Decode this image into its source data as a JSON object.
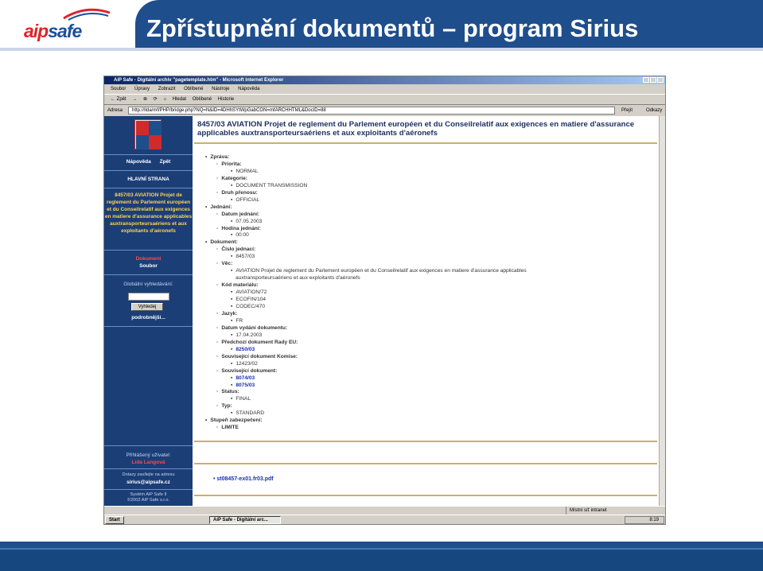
{
  "slide": {
    "logo_part1": "aip",
    "logo_part2": "safe",
    "title": "Zpřístupnění dokumentů – program Sirius"
  },
  "browser": {
    "window_title": "AiP Safe - Digitální archiv \"pagetemplate.htm\" - Microsoft Internet Explorer",
    "menu": [
      "Soubor",
      "Úpravy",
      "Zobrazit",
      "Oblíbené",
      "Nástroje",
      "Nápověda"
    ],
    "toolbar": [
      "← Zpět",
      "→",
      "⊗",
      "⟳",
      "⌂",
      "Hledat",
      "Oblíbené",
      "Historie"
    ],
    "address_label": "Adresa",
    "address_value": "http://Ilda/mf/PHP/bridge.php?NQ=N&ID=4DHhSYtWpGabCON=mfARCHHTML&DocID=88",
    "go_label": "Přejít",
    "links_label": "Odkazy",
    "status_zone": "Místní síť intranet"
  },
  "sidebar": {
    "help": "Nápověda",
    "back": "Zpět",
    "main_page": "HLAVNÍ STRANA",
    "doc_title": "8457/03 AVIATION Projet de reglement du Parlement européen et du Conseilrelatif aux exigences en matiere d'assurance applicables auxtransporteursaériens et aux exploitants d'aéronefs",
    "document_label": "Dokument",
    "file_label": "Soubor",
    "global_search": "Globální vyhledávání:",
    "search_button": "Vyhledej",
    "more": "podrobnější...",
    "logged_user_label": "Přihlášený uživatel:",
    "logged_user": "Lída Langová",
    "contact_label": "Dotazy zasílejte na adresu",
    "contact_email": "sirius@aipsafe.cz",
    "system": "Systém AiP Safe II",
    "copyright": "©2002 AiP Safe s.r.o."
  },
  "document": {
    "heading": "8457/03 AVIATION Projet de reglement du Parlement européen et du Conseilrelatif aux exigences en matiere d'assurance applicables auxtransporteursaériens et aux exploitants d'aéronefs",
    "tree": [
      {
        "level": 0,
        "text": "Zpráva:"
      },
      {
        "level": 1,
        "text": "Priorita:"
      },
      {
        "level": 2,
        "text": "NORMAL"
      },
      {
        "level": 1,
        "text": "Kategorie:"
      },
      {
        "level": 2,
        "text": "DOCUMENT TRANSMISSION"
      },
      {
        "level": 1,
        "text": "Druh přenosu:"
      },
      {
        "level": 2,
        "text": "OFFICIAL"
      },
      {
        "level": 0,
        "text": "Jednání:"
      },
      {
        "level": 1,
        "text": "Datum jednání:"
      },
      {
        "level": 2,
        "text": "07.05.2003"
      },
      {
        "level": 1,
        "text": "Hodina jednání:"
      },
      {
        "level": 2,
        "text": "00:00"
      },
      {
        "level": 0,
        "text": "Dokument:"
      },
      {
        "level": 1,
        "text": "Číslo jednací:"
      },
      {
        "level": 2,
        "text": "8457/03"
      },
      {
        "level": 1,
        "text": "Věc:"
      },
      {
        "level": 2,
        "text": "AVIATION Projet de reglement du Parlement européen et du Conseilrelatif aux exigences en matiere d'assurance applicables"
      },
      {
        "level": 3,
        "text": "auxtransporteursaériens et aux exploitants d'aéronefs"
      },
      {
        "level": 1,
        "text": "Kód materiálu:"
      },
      {
        "level": 2,
        "text": "AVIATION/72"
      },
      {
        "level": 2,
        "text": "ECOFIN/104"
      },
      {
        "level": 2,
        "text": "CODEC/470"
      },
      {
        "level": 1,
        "text": "Jazyk:"
      },
      {
        "level": 2,
        "text": "FR"
      },
      {
        "level": 1,
        "text": "Datum vydání dokumentu:"
      },
      {
        "level": 2,
        "text": "17.04.2003"
      },
      {
        "level": 1,
        "text": "Předchozí dokument Rady EU:"
      },
      {
        "level": 2,
        "text": "8250/03",
        "link": true
      },
      {
        "level": 1,
        "text": "Související dokument Komise:"
      },
      {
        "level": 2,
        "text": "12423/02"
      },
      {
        "level": 1,
        "text": "Související dokument:"
      },
      {
        "level": 2,
        "text": "8074/03",
        "link": true
      },
      {
        "level": 2,
        "text": "8075/03",
        "link": true
      },
      {
        "level": 1,
        "text": "Status:"
      },
      {
        "level": 2,
        "text": "FINAL"
      },
      {
        "level": 1,
        "text": "Typ:"
      },
      {
        "level": 2,
        "text": "STANDARD"
      },
      {
        "level": 0,
        "text": "Stupeň zabezpečení:"
      },
      {
        "level": 1,
        "text": "LIMITE"
      }
    ],
    "attachment": "st08457-ex01.fr03.pdf"
  },
  "taskbar": {
    "start": "Start",
    "task": "AiP Safe - Digitální arc...",
    "clock": "8:19"
  },
  "colors": {
    "brand_blue": "#1f4e8c",
    "brand_red": "#e0232b",
    "sidebar_blue": "#1b3e77",
    "link_blue": "#1a2fb0"
  }
}
